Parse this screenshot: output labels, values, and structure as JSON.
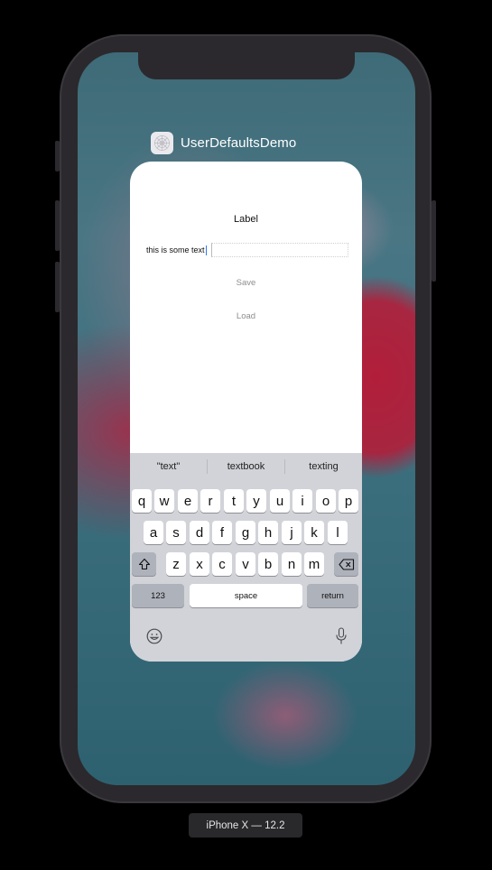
{
  "app": {
    "title": "UserDefaultsDemo"
  },
  "content": {
    "label": "Label",
    "text_field_value": "this is some text",
    "save_label": "Save",
    "load_label": "Load"
  },
  "keyboard": {
    "predictions": [
      "\"text\"",
      "textbook",
      "texting"
    ],
    "row1": [
      "q",
      "w",
      "e",
      "r",
      "t",
      "y",
      "u",
      "i",
      "o",
      "p"
    ],
    "row2": [
      "a",
      "s",
      "d",
      "f",
      "g",
      "h",
      "j",
      "k",
      "l"
    ],
    "row3": [
      "z",
      "x",
      "c",
      "v",
      "b",
      "n",
      "m"
    ],
    "numbers_label": "123",
    "space_label": "space",
    "return_label": "return",
    "icons": {
      "shift": "shift-icon",
      "delete": "delete-icon",
      "emoji": "emoji-icon",
      "mic": "microphone-icon"
    }
  },
  "device_caption": "iPhone X — 12.2",
  "colors": {
    "keyboard_bg": "#d1d3d8",
    "caret": "#3478f6",
    "frame": "#2b292d"
  }
}
